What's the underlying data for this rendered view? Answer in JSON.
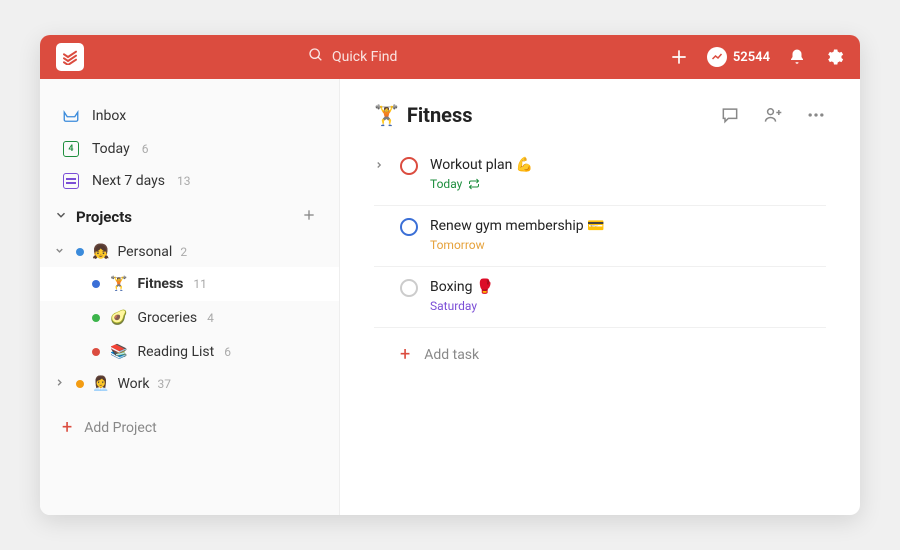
{
  "header": {
    "search_placeholder": "Quick Find",
    "karma_points": "52544"
  },
  "sidebar": {
    "inbox_label": "Inbox",
    "today_label": "Today",
    "today_count": "6",
    "today_day": "4",
    "next7_label": "Next 7 days",
    "next7_count": "13",
    "projects_label": "Projects",
    "add_project_label": "Add Project",
    "projects": [
      {
        "name": "Personal",
        "emoji": "👧",
        "count": "2",
        "color": "#3b8bdb",
        "expanded": true,
        "children": [
          {
            "name": "Fitness",
            "emoji": "🏋️",
            "count": "11",
            "color": "#3b6fd6",
            "active": true
          },
          {
            "name": "Groceries",
            "emoji": "🥑",
            "count": "4",
            "color": "#3cb44b"
          },
          {
            "name": "Reading List",
            "emoji": "📚",
            "count": "6",
            "color": "#db4c3f"
          }
        ]
      },
      {
        "name": "Work",
        "emoji": "👩‍💼",
        "count": "37",
        "color": "#f39c12",
        "expanded": false
      }
    ]
  },
  "main": {
    "title_emoji": "🏋️",
    "title": "Fitness",
    "add_task_label": "Add task",
    "tasks": [
      {
        "title": "Workout plan 💪",
        "due_label": "Today",
        "due_class": "today",
        "priority": "p1",
        "recurring": true,
        "expandable": true
      },
      {
        "title": "Renew gym membership 💳",
        "due_label": "Tomorrow",
        "due_class": "tomorrow",
        "priority": "p2"
      },
      {
        "title": "Boxing 🥊",
        "due_label": "Saturday",
        "due_class": "saturday",
        "priority": ""
      }
    ]
  }
}
